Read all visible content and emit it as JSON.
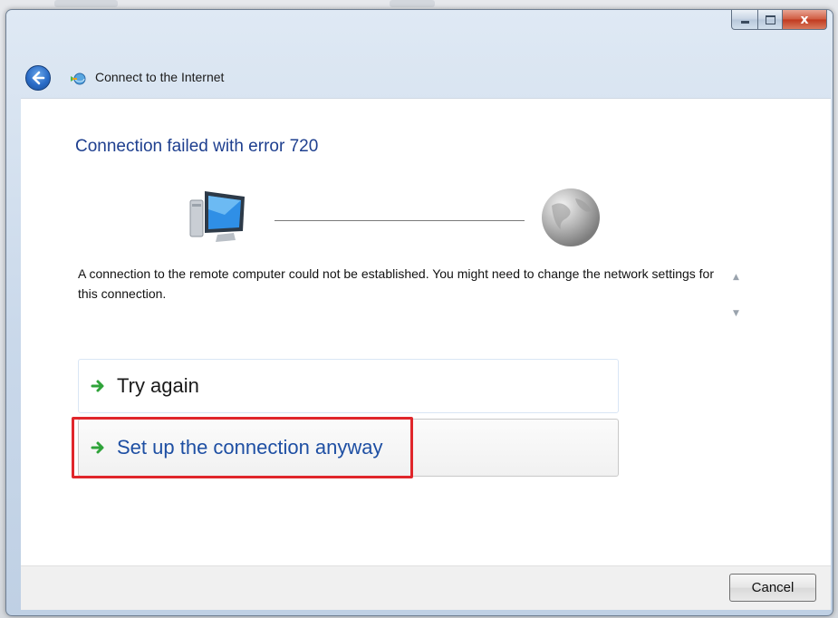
{
  "window": {
    "title": "Connect to the Internet",
    "caption": {
      "minimize_icon": "minimize-icon",
      "maximize_icon": "maximize-icon",
      "close_glyph": "x"
    }
  },
  "wizard": {
    "heading": "Connection failed with error 720",
    "message": "A connection to the remote computer could not be established.  You might need to change the network settings for this connection.",
    "options": [
      {
        "label": "Try again",
        "icon": "green-arrow-icon"
      },
      {
        "label": "Set up the connection anyway",
        "icon": "green-arrow-icon",
        "highlighted": true
      }
    ]
  },
  "footer": {
    "cancel_label": "Cancel"
  },
  "colors": {
    "heading": "#1e3f8f",
    "link": "#1e4fa3",
    "highlight": "#e0262b",
    "arrow": "#2fa33a"
  }
}
